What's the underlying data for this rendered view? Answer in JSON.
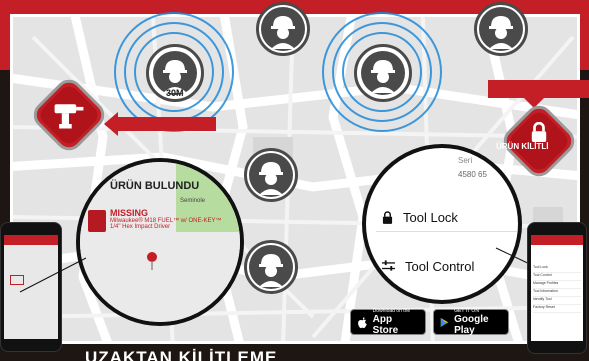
{
  "map": {
    "distance_label": "30M",
    "lock_badge_label": "ÜRÜN KİLİTLİ"
  },
  "found_panel": {
    "title": "ÜRÜN BULUNDU",
    "missing_title": "MISSING",
    "missing_desc_line1": "Milwaukee® M18 FUEL™ w/ ONE-KEY™",
    "missing_desc_line2": "1/4\" Hex Impact Driver",
    "street_label": "Seminole"
  },
  "control_panel": {
    "serial_label": "Seri",
    "serial_value": "4580 65",
    "tool_lock_label": "Tool Lock",
    "tool_control_label": "Tool Control"
  },
  "phone_right": {
    "menu_items": [
      "Tool Lock",
      "Tool Control",
      "Manage Profiles",
      "Tool Information",
      "Identify Tool",
      "Factory Reset"
    ]
  },
  "stores": {
    "appstore_small": "Download on the",
    "appstore_large": "App Store",
    "googleplay_small": "GET IT ON",
    "googleplay_large": "Google Play"
  },
  "bottom_text": "UZAKTAN KİLİTLEME",
  "colors": {
    "brand_red": "#c41e26",
    "ring_blue": "#1e88d8",
    "worker_gray": "#4a4a4a"
  }
}
